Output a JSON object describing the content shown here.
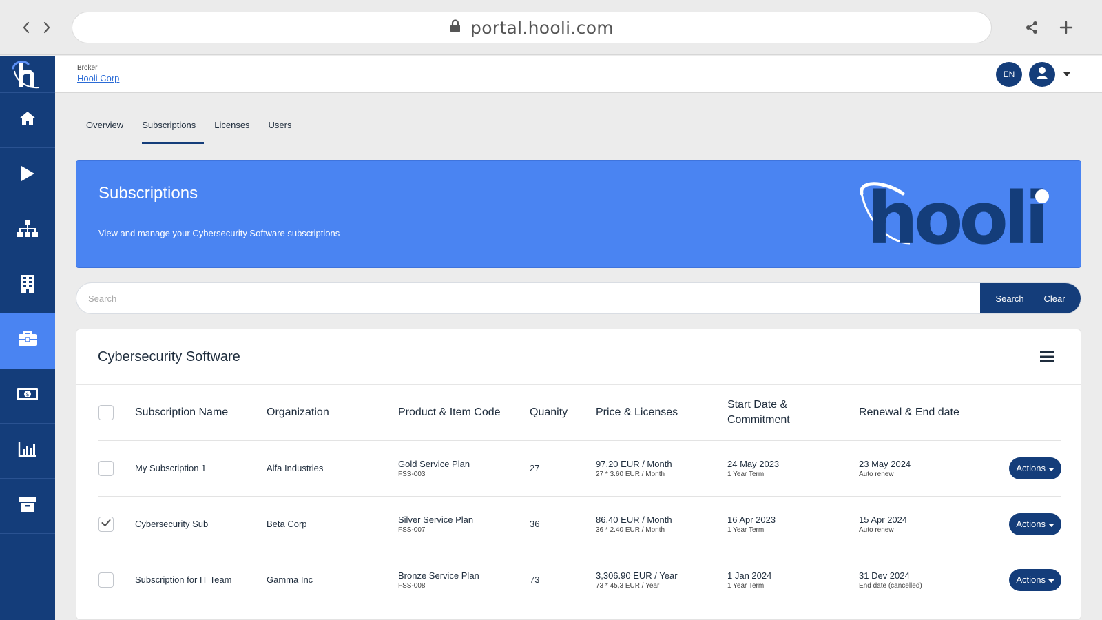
{
  "browser": {
    "url": "portal.hooli.com"
  },
  "header": {
    "broker_label": "Broker",
    "broker_name": "Hooli Corp",
    "language": "EN"
  },
  "sidebar": {
    "items": [
      {
        "icon": "home-icon"
      },
      {
        "icon": "play-icon"
      },
      {
        "icon": "sitemap-icon"
      },
      {
        "icon": "building-icon"
      },
      {
        "icon": "briefcase-icon",
        "active": true
      },
      {
        "icon": "money-icon"
      },
      {
        "icon": "chart-icon"
      },
      {
        "icon": "archive-icon"
      }
    ]
  },
  "tabs": [
    {
      "label": "Overview"
    },
    {
      "label": "Subscriptions",
      "active": true
    },
    {
      "label": "Licenses"
    },
    {
      "label": "Users"
    }
  ],
  "banner": {
    "title": "Subscriptions",
    "subtitle": "View and manage your Cybersecurity Software subscriptions",
    "logo_text": "hooli"
  },
  "search": {
    "placeholder": "Search",
    "search_label": "Search",
    "clear_label": "Clear"
  },
  "card": {
    "title": "Cybersecurity Software"
  },
  "table": {
    "headers": {
      "name": "Subscription Name",
      "org": "Organization",
      "product": "Product & Item Code",
      "qty": "Quanity",
      "price_line1": "Price & Licenses",
      "start_line1": "Start Date &",
      "start_line2": "Commitment",
      "renewal": "Renewal & End date"
    },
    "actions_label": "Actions",
    "rows": [
      {
        "checked": false,
        "name": "My Subscription 1",
        "org": "Alfa Industries",
        "product": "Gold Service Plan",
        "code": "FSS-003",
        "qty": "27",
        "price": "97.20 EUR / Month",
        "licenses": "27 * 3.60 EUR / Month",
        "start": "24 May 2023",
        "term": "1 Year Term",
        "renewal": "23 May 2024",
        "renewal_note": "Auto renew"
      },
      {
        "checked": true,
        "name": "Cybersecurity Sub",
        "org": "Beta Corp",
        "product": "Silver Service Plan",
        "code": "FSS-007",
        "qty": "36",
        "price": "86.40 EUR / Month",
        "licenses": "36 * 2.40 EUR / Month",
        "start": "16 Apr 2023",
        "term": "1 Year Term",
        "renewal": "15 Apr 2024",
        "renewal_note": "Auto renew"
      },
      {
        "checked": false,
        "name": "Subscription for IT Team",
        "org": "Gamma Inc",
        "product": "Bronze Service Plan",
        "code": "FSS-008",
        "qty": "73",
        "price": "3,306.90 EUR / Year",
        "licenses": "73 * 45,3 EUR / Year",
        "start": "1 Jan 2024",
        "term": "1 Year Term",
        "renewal": "31 Dev 2024",
        "renewal_note": "End date (cancelled)"
      }
    ]
  },
  "colors": {
    "navy": "#143d7a",
    "accent_blue": "#4a84f2"
  }
}
